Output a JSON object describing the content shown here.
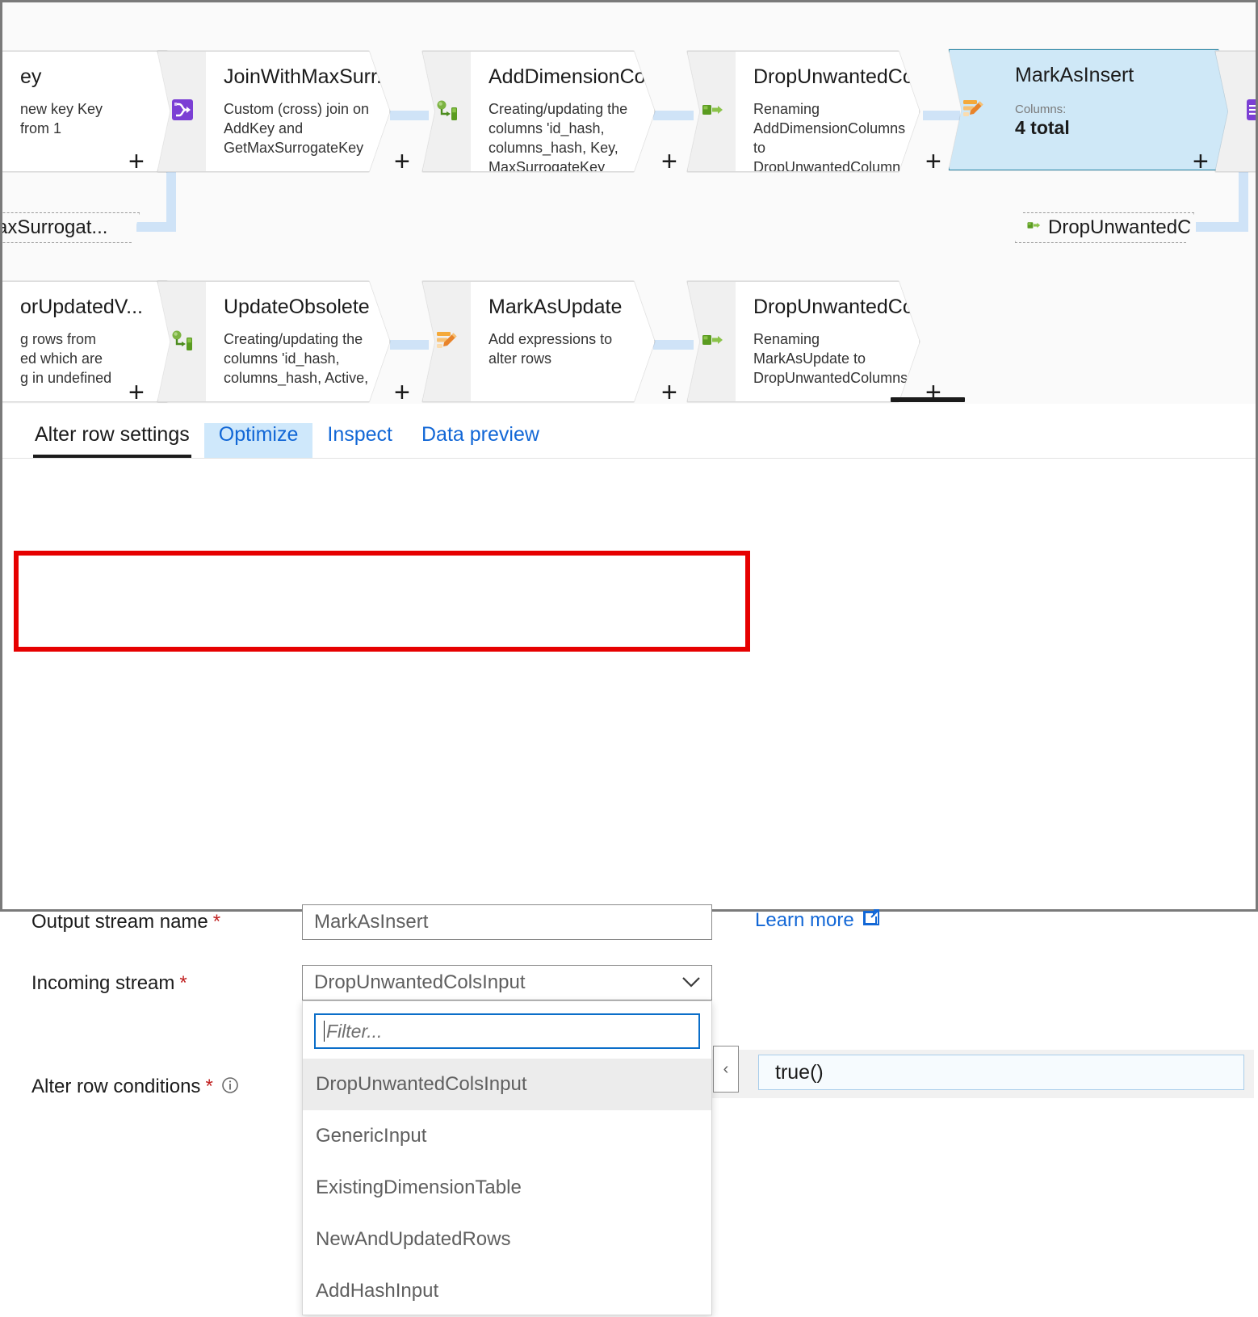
{
  "canvas": {
    "nodes": [
      {
        "id": "addkey-partial",
        "title": "ey",
        "desc": "new key Key\nfrom 1",
        "icon": "derived-column-icon"
      },
      {
        "id": "joinwithmaxsurrogatekey",
        "title": "JoinWithMaxSurr...",
        "desc": "Custom (cross) join on AddKey and GetMaxSurrogateKey",
        "icon": "join-icon"
      },
      {
        "id": "adddimensioncolumns",
        "title": "AddDimensionCol...",
        "desc": "Creating/updating the columns 'id_hash, columns_hash, Key, MaxSurrogateKey",
        "icon": "derived-column-icon"
      },
      {
        "id": "dropunwantedcolumns-1",
        "title": "DropUnwantedCo...",
        "desc": "Renaming AddDimensionColumns to DropUnwantedColumns",
        "icon": "select-icon"
      },
      {
        "id": "markasinsert",
        "title": "MarkAsInsert",
        "sub_label": "Columns:",
        "sub_value": "4 total",
        "icon": "alter-row-icon",
        "selected": true
      },
      {
        "id": "right-partial-join",
        "title": "",
        "desc": "",
        "icon": "union-icon"
      },
      {
        "id": "checkforupdatedversions-partial",
        "title": "orUpdatedV...",
        "desc": "g rows from\ned which are\ng in undefined",
        "icon": "derived-column-icon"
      },
      {
        "id": "updateobsolete",
        "title": "UpdateObsolete",
        "desc": "Creating/updating the columns 'id_hash, columns_hash, Active,",
        "icon": "derived-column-icon"
      },
      {
        "id": "markasupdate",
        "title": "MarkAsUpdate",
        "desc": "Add expressions to alter rows",
        "icon": "alter-row-icon"
      },
      {
        "id": "dropunwantedcolumns-2",
        "title": "DropUnwantedCo...",
        "desc": "Renaming MarkAsUpdate to DropUnwantedColumns",
        "icon": "select-icon"
      }
    ],
    "reference_pills": [
      {
        "id": "getmaxsurrogatekey-ref",
        "label": "etMaxSurrogat...",
        "icon": ""
      },
      {
        "id": "dropunwantedcols-ref",
        "label": "DropUnwantedC...",
        "icon": "select-icon"
      }
    ],
    "add_button_label": "+"
  },
  "panel": {
    "tabs": [
      {
        "id": "alter-row-settings",
        "label": "Alter row settings",
        "state": "active"
      },
      {
        "id": "optimize",
        "label": "Optimize",
        "state": "hovered"
      },
      {
        "id": "inspect",
        "label": "Inspect",
        "state": "normal"
      },
      {
        "id": "data-preview",
        "label": "Data preview",
        "state": "normal"
      }
    ],
    "output_stream": {
      "label": "Output stream name",
      "required_marker": "*",
      "value": "MarkAsInsert"
    },
    "learn_more": {
      "label": "Learn more",
      "icon": "external-link-icon"
    },
    "incoming_stream": {
      "label": "Incoming stream",
      "required_marker": "*",
      "value": "DropUnwantedColsInput",
      "chevron": "∨"
    },
    "alter_row_conditions": {
      "label": "Alter row conditions",
      "required_marker": "*",
      "info_icon": "info-icon",
      "condition_type_value": "‹",
      "expression": "true()"
    },
    "dropdown": {
      "filter_placeholder": "Filter...",
      "options": [
        {
          "label": "DropUnwantedColsInput",
          "selected": true
        },
        {
          "label": "GenericInput",
          "selected": false
        },
        {
          "label": "ExistingDimensionTable",
          "selected": false
        },
        {
          "label": "NewAndUpdatedRows",
          "selected": false
        },
        {
          "label": "AddHashInput",
          "selected": false
        }
      ]
    }
  },
  "annotation": {
    "highlight_color": "#e60000"
  },
  "colors": {
    "accent_blue": "#1267d6",
    "selected_node_fill": "#cfe8f7",
    "selected_node_border": "#2b88a8",
    "link_line": "#cfe3f7",
    "required_red": "#c02020"
  }
}
